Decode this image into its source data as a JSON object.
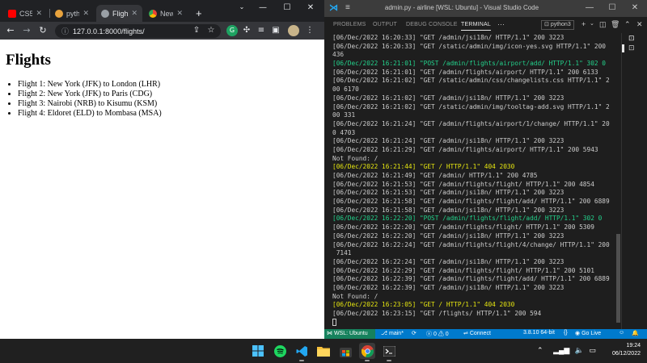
{
  "chrome": {
    "tabs": [
      {
        "label": "CS50",
        "icon": "youtube-icon"
      },
      {
        "label": "pytho",
        "icon": "python-icon"
      },
      {
        "label": "Fligh",
        "icon": "globe-icon",
        "active": true
      },
      {
        "label": "New",
        "icon": "chrome-icon"
      }
    ],
    "url": "127.0.0.1:8000/flights/"
  },
  "page": {
    "title": "Flights",
    "flights": [
      "Flight 1: New York (JFK) to London (LHR)",
      "Flight 2: New York (JFK) to Paris (CDG)",
      "Flight 3: Nairobi (NRB) to Kisumu (KSM)",
      "Flight 4: Eldoret (ELD) to Mombasa (MSA)"
    ]
  },
  "vscode": {
    "title": "admin.py - airline [WSL: Ubuntu] - Visual Studio Code",
    "panel_tabs": [
      "PROBLEMS",
      "OUTPUT",
      "DEBUG CONSOLE",
      "TERMINAL"
    ],
    "terminal_name": "python3",
    "terminal_lines": [
      {
        "text": "[06/Dec/2022 16:20:33] \"GET /admin/jsi18n/ HTTP/1.1\" 200 3223",
        "color": "#cccccc"
      },
      {
        "text": "[06/Dec/2022 16:20:33] \"GET /static/admin/img/icon-yes.svg HTTP/1.1\" 200",
        "color": "#cccccc"
      },
      {
        "text": "436",
        "color": "#cccccc"
      },
      {
        "text": "[06/Dec/2022 16:21:01] \"POST /admin/flights/airport/add/ HTTP/1.1\" 302 0",
        "color": "#23d18b"
      },
      {
        "text": "[06/Dec/2022 16:21:01] \"GET /admin/flights/airport/ HTTP/1.1\" 200 6133",
        "color": "#cccccc"
      },
      {
        "text": "[06/Dec/2022 16:21:02] \"GET /static/admin/css/changelists.css HTTP/1.1\" 2",
        "color": "#cccccc"
      },
      {
        "text": "00 6170",
        "color": "#cccccc"
      },
      {
        "text": "[06/Dec/2022 16:21:02] \"GET /admin/jsi18n/ HTTP/1.1\" 200 3223",
        "color": "#cccccc"
      },
      {
        "text": "[06/Dec/2022 16:21:02] \"GET /static/admin/img/tooltag-add.svg HTTP/1.1\" 2",
        "color": "#cccccc"
      },
      {
        "text": "00 331",
        "color": "#cccccc"
      },
      {
        "text": "[06/Dec/2022 16:21:24] \"GET /admin/flights/airport/1/change/ HTTP/1.1\" 20",
        "color": "#cccccc"
      },
      {
        "text": "0 4703",
        "color": "#cccccc"
      },
      {
        "text": "[06/Dec/2022 16:21:24] \"GET /admin/jsi18n/ HTTP/1.1\" 200 3223",
        "color": "#cccccc"
      },
      {
        "text": "[06/Dec/2022 16:21:29] \"GET /admin/flights/airport/ HTTP/1.1\" 200 5943",
        "color": "#cccccc"
      },
      {
        "text": "Not Found: /",
        "color": "#cccccc"
      },
      {
        "text": "[06/Dec/2022 16:21:44] \"GET / HTTP/1.1\" 404 2030",
        "color": "#e5e510"
      },
      {
        "text": "[06/Dec/2022 16:21:49] \"GET /admin/ HTTP/1.1\" 200 4785",
        "color": "#cccccc"
      },
      {
        "text": "[06/Dec/2022 16:21:53] \"GET /admin/flights/flight/ HTTP/1.1\" 200 4854",
        "color": "#cccccc"
      },
      {
        "text": "[06/Dec/2022 16:21:53] \"GET /admin/jsi18n/ HTTP/1.1\" 200 3223",
        "color": "#cccccc"
      },
      {
        "text": "[06/Dec/2022 16:21:58] \"GET /admin/flights/flight/add/ HTTP/1.1\" 200 6889",
        "color": "#cccccc"
      },
      {
        "text": "[06/Dec/2022 16:21:58] \"GET /admin/jsi18n/ HTTP/1.1\" 200 3223",
        "color": "#cccccc"
      },
      {
        "text": "[06/Dec/2022 16:22:20] \"POST /admin/flights/flight/add/ HTTP/1.1\" 302 0",
        "color": "#23d18b"
      },
      {
        "text": "[06/Dec/2022 16:22:20] \"GET /admin/flights/flight/ HTTP/1.1\" 200 5309",
        "color": "#cccccc"
      },
      {
        "text": "[06/Dec/2022 16:22:20] \"GET /admin/jsi18n/ HTTP/1.1\" 200 3223",
        "color": "#cccccc"
      },
      {
        "text": "[06/Dec/2022 16:22:24] \"GET /admin/flights/flight/4/change/ HTTP/1.1\" 200",
        "color": "#cccccc"
      },
      {
        "text": " 7141",
        "color": "#cccccc"
      },
      {
        "text": "[06/Dec/2022 16:22:24] \"GET /admin/jsi18n/ HTTP/1.1\" 200 3223",
        "color": "#cccccc"
      },
      {
        "text": "[06/Dec/2022 16:22:29] \"GET /admin/flights/flight/ HTTP/1.1\" 200 5101",
        "color": "#cccccc"
      },
      {
        "text": "[06/Dec/2022 16:22:39] \"GET /admin/flights/flight/add/ HTTP/1.1\" 200 6889",
        "color": "#cccccc"
      },
      {
        "text": "[06/Dec/2022 16:22:39] \"GET /admin/jsi18n/ HTTP/1.1\" 200 3223",
        "color": "#cccccc"
      },
      {
        "text": "Not Found: /",
        "color": "#cccccc"
      },
      {
        "text": "[06/Dec/2022 16:23:05] \"GET / HTTP/1.1\" 404 2030",
        "color": "#e5e510"
      },
      {
        "text": "[06/Dec/2022 16:23:15] \"GET /flights/ HTTP/1.1\" 200 594",
        "color": "#cccccc"
      }
    ],
    "status": {
      "remote": "WSL: Ubuntu",
      "branch": "main*",
      "errors": "0",
      "warnings": "0",
      "connect": "Connect",
      "python": "3.8.10 64-bit",
      "golive": "Go Live"
    }
  },
  "taskbar": {
    "time": "19:24",
    "date": "06/12/2022"
  }
}
